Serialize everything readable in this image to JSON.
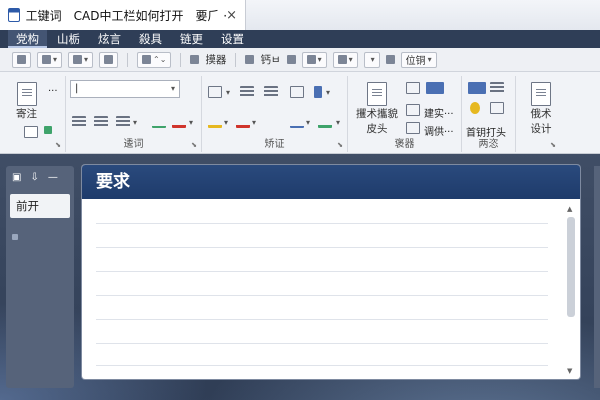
{
  "window": {
    "title": "工键词　CAD中工栏如何打开　要⺁ ··",
    "close_glyph": "×"
  },
  "menu": {
    "items": [
      "党构",
      "山栃",
      "炫言",
      "殺具",
      "链更",
      "设置"
    ]
  },
  "toolbar": {
    "button1_label": "摸器",
    "button2_label": "钙ㅂ",
    "button3_label": "位铜"
  },
  "ribbon": {
    "groups": {
      "clipboard": {
        "big_label_1": "寄注",
        "big_label_2": "···"
      },
      "font": {
        "label": "逶词",
        "font_value": "|"
      },
      "paragraph": {
        "label": "矫证"
      },
      "insert": {
        "label": "褒器",
        "big_label": "攫术攜貌 皮头",
        "item1": "建实···",
        "item2": "调供···"
      },
      "review": {
        "label": "两恣",
        "big_label": "首钥打头"
      },
      "design": {
        "big_label": "俄术 设计"
      }
    }
  },
  "left_pane": {
    "item": "前开"
  },
  "document": {
    "heading": "要求"
  },
  "colors": {
    "accent": "#1e3b6b",
    "menubar": "#2f3e57"
  }
}
